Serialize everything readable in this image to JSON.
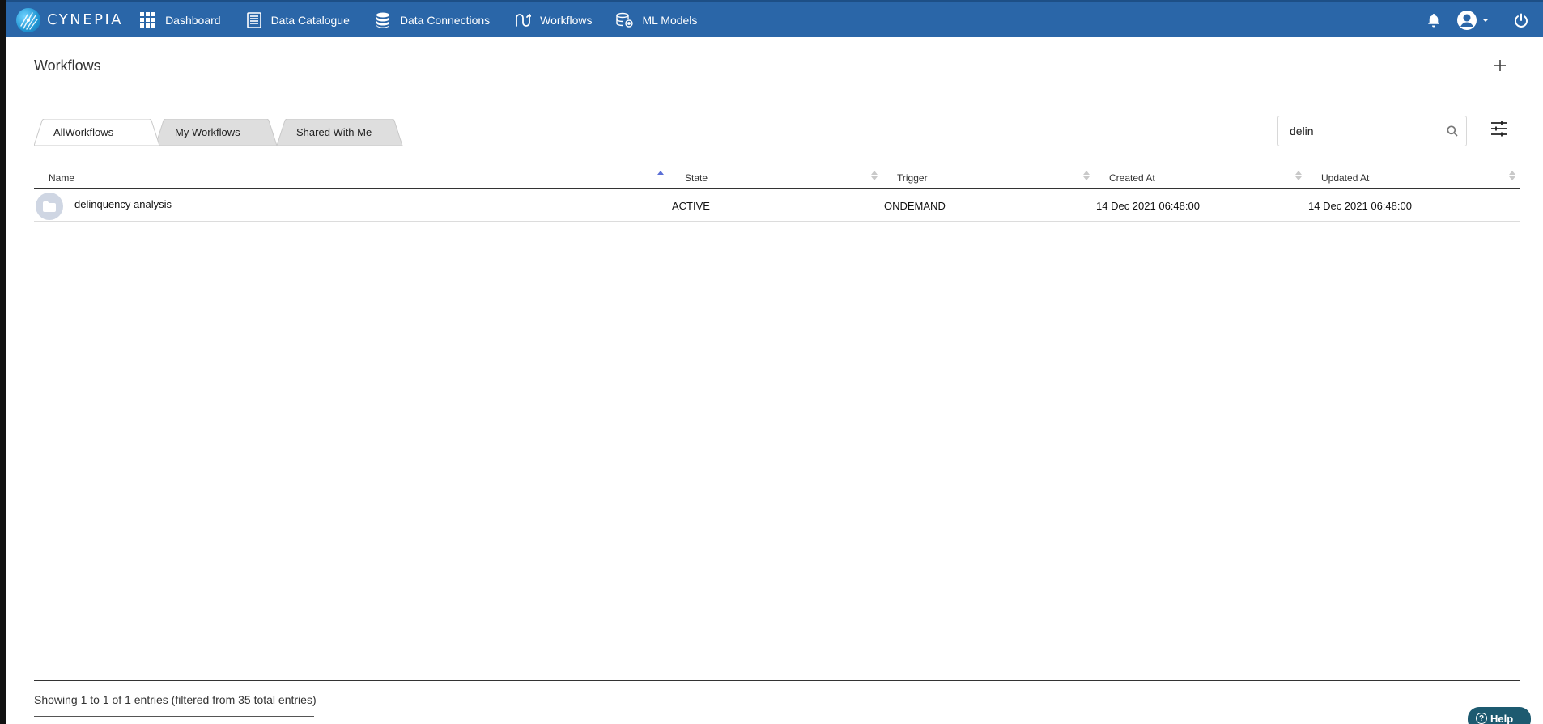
{
  "app": {
    "brand": "CYNEPIA"
  },
  "nav": {
    "items": [
      {
        "label": "Dashboard",
        "icon": "grid-icon"
      },
      {
        "label": "Data Catalogue",
        "icon": "document-icon"
      },
      {
        "label": "Data Connections",
        "icon": "database-icon"
      },
      {
        "label": "Workflows",
        "icon": "workflow-icon"
      },
      {
        "label": "ML Models",
        "icon": "ml-model-icon"
      }
    ],
    "right_icons": [
      "bell-icon",
      "user-avatar-icon",
      "power-icon"
    ]
  },
  "page": {
    "title": "Workflows"
  },
  "tabs": [
    {
      "label": "AllWorkflows",
      "active": true
    },
    {
      "label": "My Workflows",
      "active": false
    },
    {
      "label": "Shared With Me",
      "active": false
    }
  ],
  "search": {
    "value": "delin",
    "placeholder": ""
  },
  "table": {
    "columns": [
      "Name",
      "State",
      "Trigger",
      "Created At",
      "Updated At"
    ],
    "sorted_column": "Name",
    "sort_direction": "ascending",
    "rows": [
      {
        "name": "delinquency analysis",
        "state": "ACTIVE",
        "trigger": "ONDEMAND",
        "created_at": "14 Dec 2021 06:48:00",
        "updated_at": "14 Dec 2021 06:48:00"
      }
    ]
  },
  "footer": {
    "info": "Showing 1 to 1 of 1 entries (filtered from 35 total entries)"
  },
  "help": {
    "label": "Help"
  },
  "colors": {
    "topbar": "#2a66a8",
    "help_button": "#1d5a70",
    "sort_active": "#5b6fd6"
  }
}
